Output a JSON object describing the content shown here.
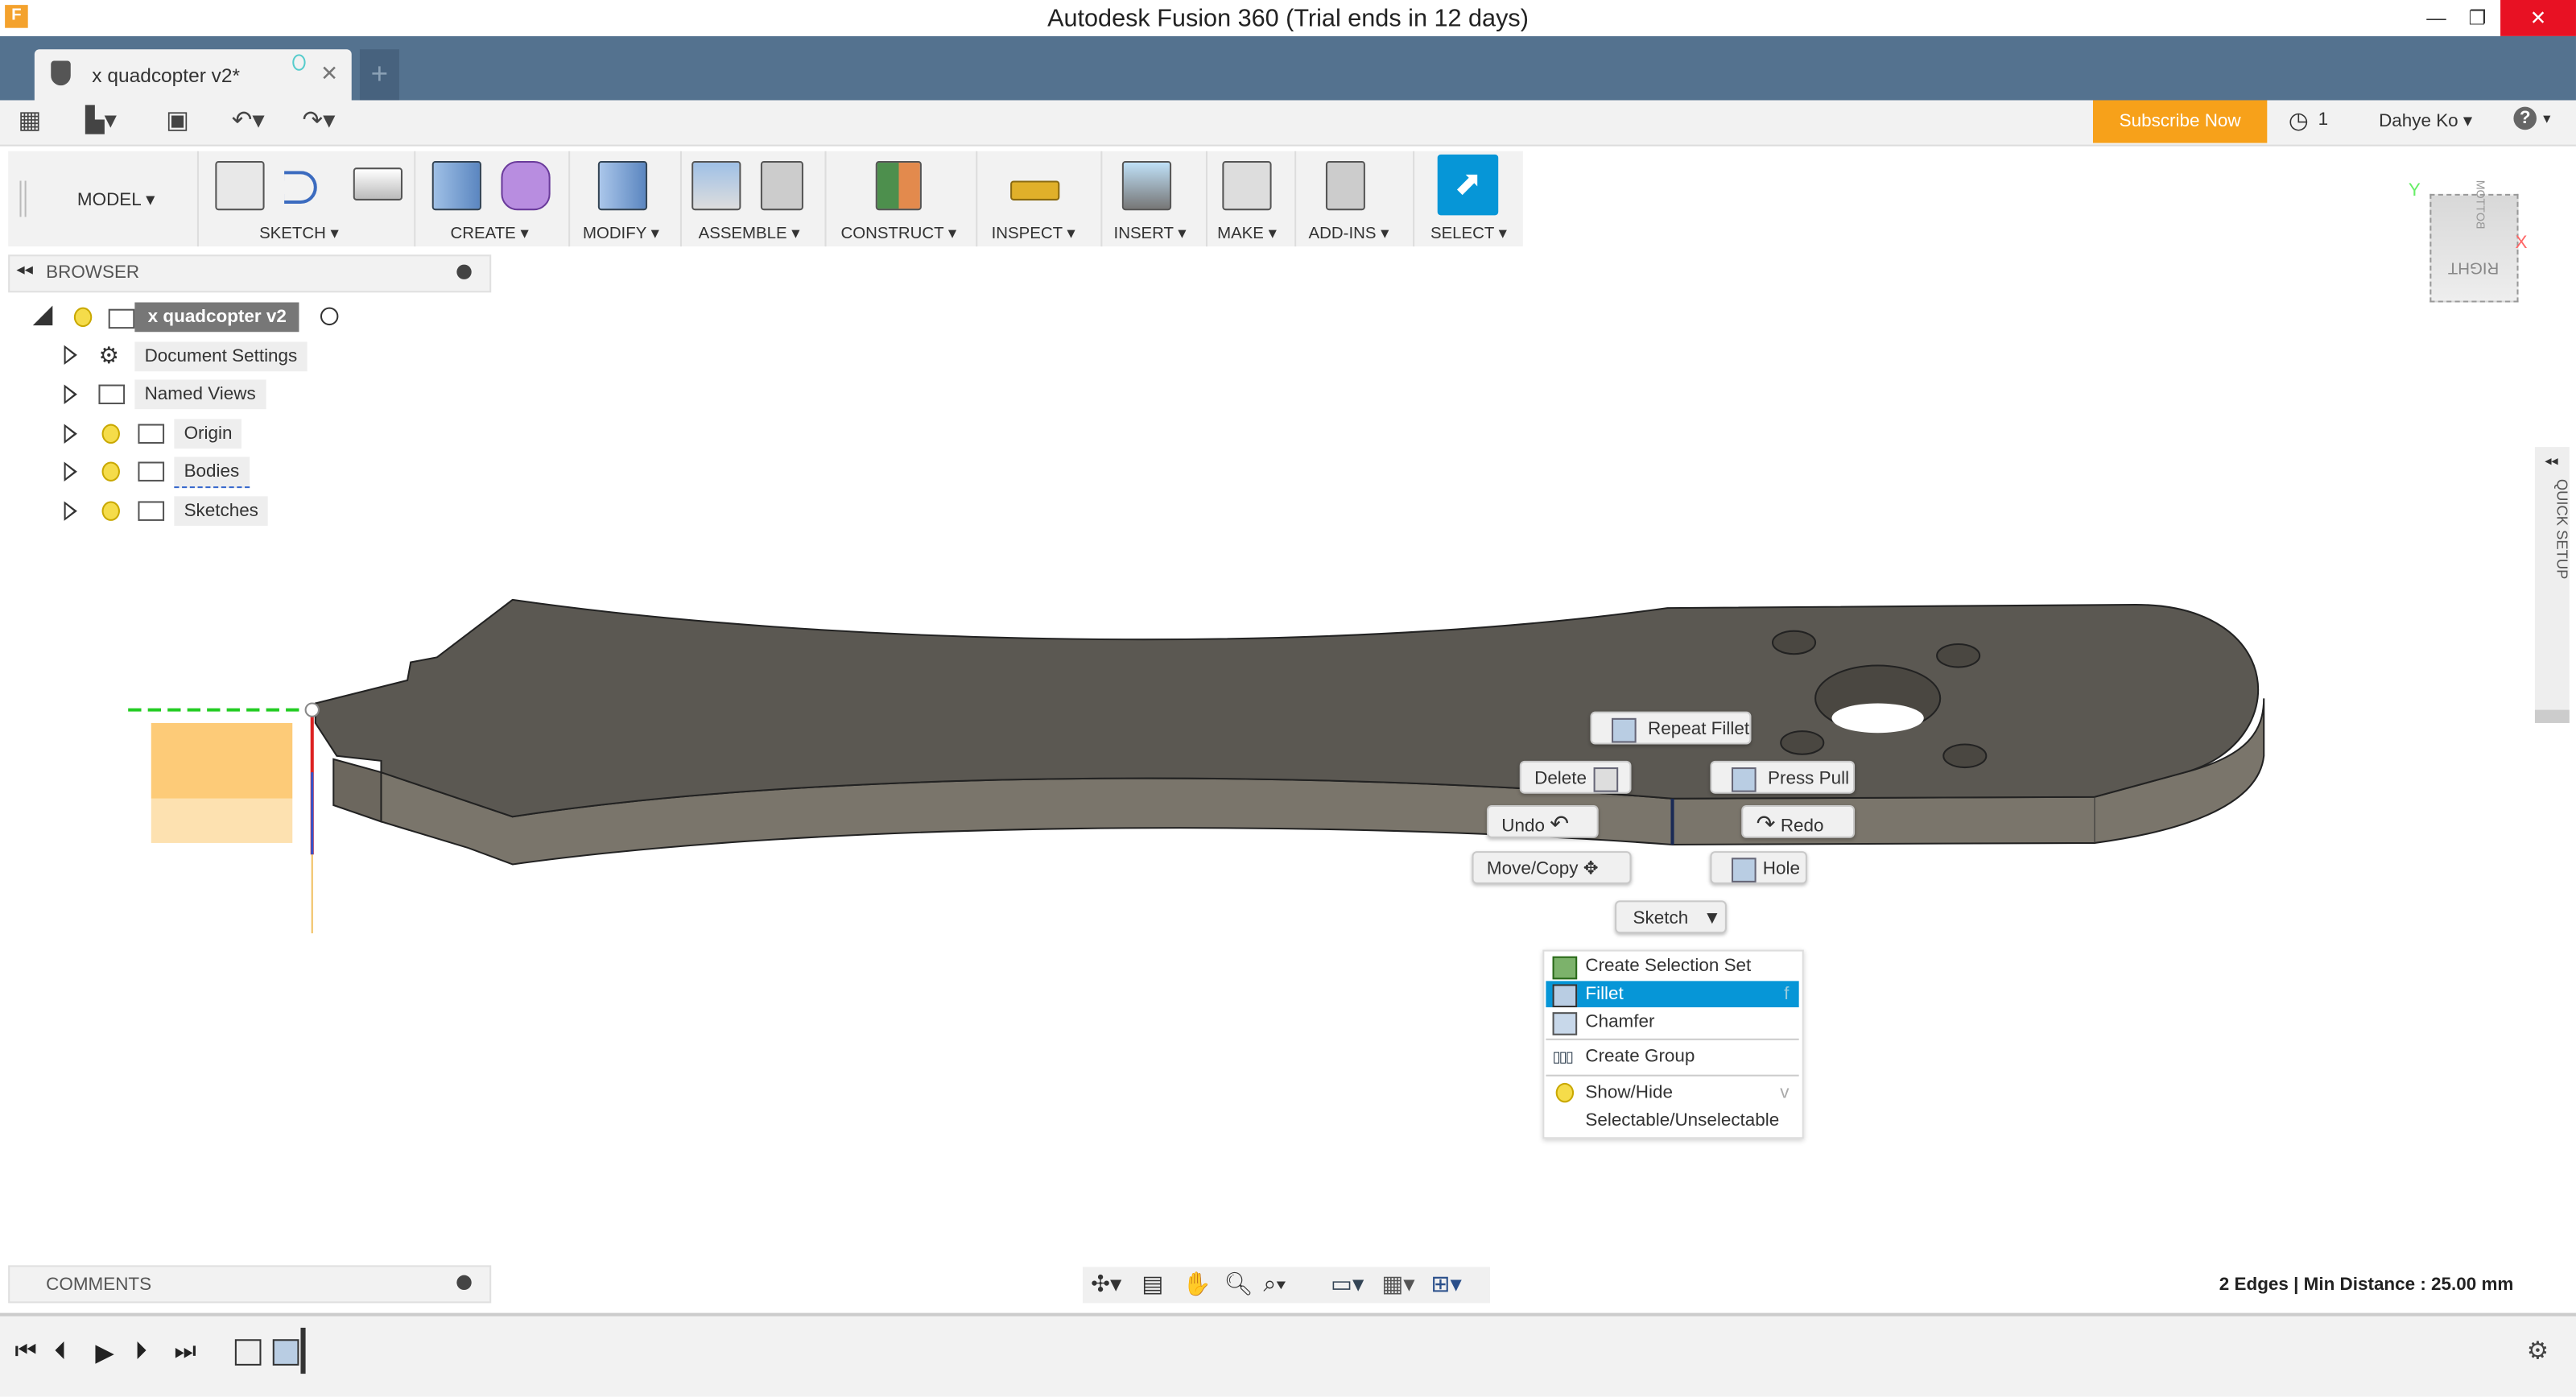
{
  "window": {
    "title": "Autodesk Fusion 360 (Trial ends in 12 days)",
    "app_icon": "F"
  },
  "tab": {
    "label": "x quadcopter v2*",
    "new_tab": "+"
  },
  "header": {
    "subscribe": "Subscribe Now",
    "jobs_count": "1",
    "user": "Dahye Ko",
    "accent": "#f7a11a"
  },
  "ribbon": {
    "workspace": "MODEL",
    "groups": [
      "SKETCH",
      "CREATE",
      "MODIFY",
      "ASSEMBLE",
      "CONSTRUCT",
      "INSPECT",
      "INSERT",
      "MAKE",
      "ADD-INS",
      "SELECT"
    ]
  },
  "browser": {
    "title": "BROWSER",
    "root": "x quadcopter v2",
    "items": [
      "Document Settings",
      "Named Views",
      "Origin",
      "Bodies",
      "Sketches"
    ]
  },
  "viewcube": {
    "faces": [
      "BOTTOM",
      "RIGHT"
    ],
    "axes": [
      "Y",
      "X"
    ]
  },
  "quick_setup": "QUICK SETUP",
  "marking_menu": {
    "repeat": "Repeat Fillet",
    "delete": "Delete",
    "press_pull": "Press Pull",
    "undo": "Undo",
    "redo": "Redo",
    "move_copy": "Move/Copy",
    "hole": "Hole",
    "sketch": "Sketch"
  },
  "context_menu": {
    "items": [
      {
        "label": "Create Selection Set",
        "shortcut": ""
      },
      {
        "label": "Fillet",
        "shortcut": "f",
        "highlighted": true
      },
      {
        "label": "Chamfer",
        "shortcut": ""
      },
      {
        "label": "Create Group",
        "shortcut": ""
      },
      {
        "label": "Show/Hide",
        "shortcut": "v"
      },
      {
        "label": "Selectable/Unselectable",
        "shortcut": ""
      }
    ],
    "highlight": "#0696d7"
  },
  "comments": {
    "title": "COMMENTS"
  },
  "status": "2 Edges | Min Distance : 25.00 mm",
  "part_color": "#5b5852"
}
